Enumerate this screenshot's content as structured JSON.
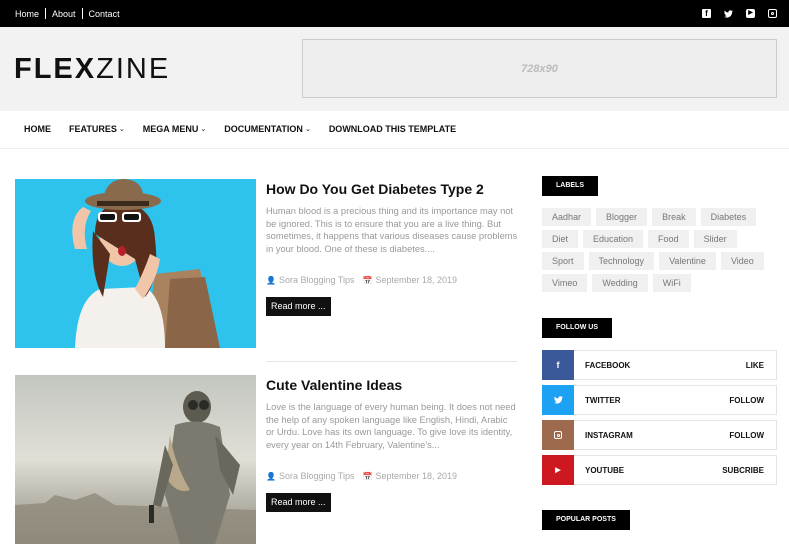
{
  "topbar": {
    "links": [
      "Home",
      "About",
      "Contact"
    ],
    "social_icons": [
      "facebook-icon",
      "twitter-icon",
      "youtube-icon",
      "instagram-icon"
    ]
  },
  "header": {
    "logo_bold": "FLEX",
    "logo_light": "ZINE",
    "ad_text": "728x90"
  },
  "nav": {
    "items": [
      {
        "label": "HOME",
        "dropdown": false
      },
      {
        "label": "FEATURES",
        "dropdown": true
      },
      {
        "label": "MEGA MENU",
        "dropdown": true
      },
      {
        "label": "DOCUMENTATION",
        "dropdown": true
      },
      {
        "label": "DOWNLOAD THIS TEMPLATE",
        "dropdown": false
      }
    ]
  },
  "posts": [
    {
      "title": "How Do You Get Diabetes Type 2",
      "excerpt": "Human blood is a precious thing and its importance may not be ignored. This is to ensure that you are a live thing. But sometimes, it happens that various diseases cause problems in your blood. One of these is diabetes....",
      "author": "Sora Blogging Tips",
      "date": "September 18, 2019",
      "read_more": "Read more ..."
    },
    {
      "title": "Cute Valentine Ideas",
      "excerpt": "Love is the language of every human being. It does not need the help of any spoken language like English, Hindi, Arabic or Urdu. Love has its own language. To give love its identity, every year on 14th February, Valentine's...",
      "author": "Sora Blogging Tips",
      "date": "September 18, 2019",
      "read_more": "Read more ..."
    }
  ],
  "sidebar": {
    "labels_title": "LABELS",
    "labels": [
      "Aadhar",
      "Blogger",
      "Break",
      "Diabetes",
      "Diet",
      "Education",
      "Food",
      "Slider",
      "Sport",
      "Technology",
      "Valentine",
      "Video",
      "Vimeo",
      "Wedding",
      "WiFi"
    ],
    "follow_title": "FOLLOW US",
    "social": [
      {
        "name": "FACEBOOK",
        "action": "LIKE",
        "color": "#3b5998",
        "glyph": "f"
      },
      {
        "name": "TWITTER",
        "action": "FOLLOW",
        "color": "#1da1f2",
        "glyph": "t"
      },
      {
        "name": "INSTAGRAM",
        "action": "FOLLOW",
        "color": "#9e6a4e",
        "glyph": ""
      },
      {
        "name": "YOUTUBE",
        "action": "SUBCRIBE",
        "color": "#cc181e",
        "glyph": "▶"
      }
    ],
    "popular_title": "POPULAR POSTS"
  }
}
